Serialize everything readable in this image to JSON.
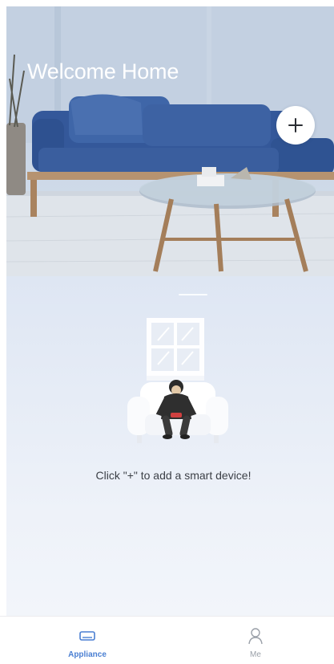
{
  "hero": {
    "title": "Welcome Home",
    "add_button_icon": "plus-icon"
  },
  "empty_state": {
    "message": "Click \"+\" to add a smart device!"
  },
  "tab_bar": {
    "tabs": [
      {
        "label": "Appliance",
        "icon": "appliance-icon",
        "active": true
      },
      {
        "label": "Me",
        "icon": "person-icon",
        "active": false
      }
    ]
  },
  "colors": {
    "accent": "#4a7fd2",
    "inactive": "#9aa0a8",
    "sofa": "#3f66a8",
    "text": "#3b3f46"
  }
}
